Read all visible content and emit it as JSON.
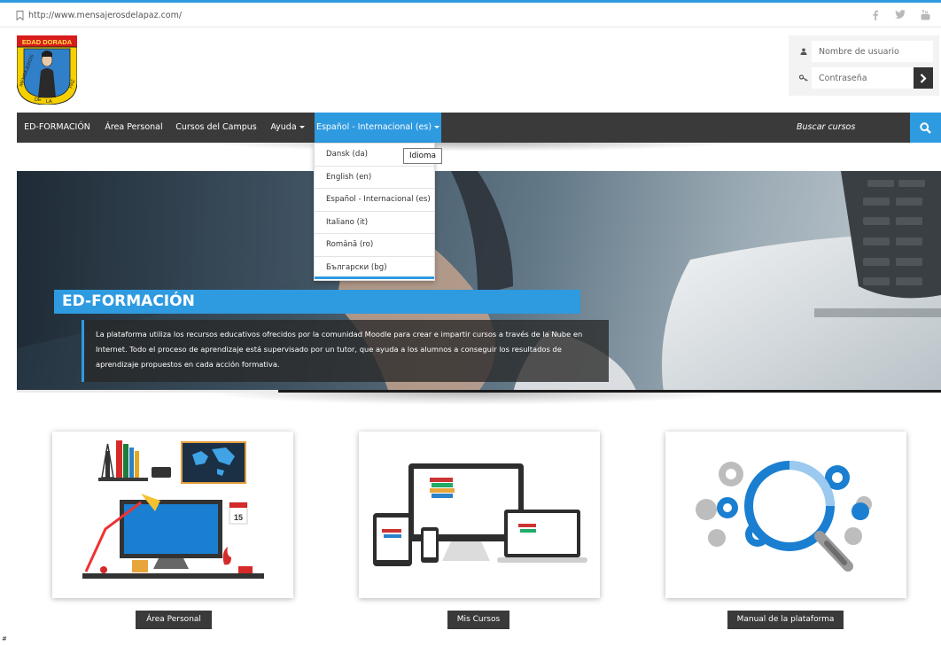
{
  "top_bar": {
    "url": "http://www.mensajerosdelapaz.com/",
    "social_icons": [
      "facebook-icon",
      "twitter-icon",
      "youtube-icon"
    ]
  },
  "logo": {
    "top_text": "EDAD DORADA",
    "ring_text": "MENSAJEROS DE LA PAZ"
  },
  "login": {
    "username_placeholder": "Nombre de usuario",
    "password_placeholder": "Contraseña"
  },
  "nav": {
    "items": [
      {
        "label": "ED-FORMACIÓN"
      },
      {
        "label": "Área Personal"
      },
      {
        "label": "Cursos del Campus"
      },
      {
        "label": "Ayuda"
      },
      {
        "label": "Español - Internacional (es)"
      }
    ],
    "search_label": "Buscar cursos"
  },
  "language_menu": {
    "options": [
      "Dansk (da)",
      "English (en)",
      "Español - Internacional (es)",
      "Italiano (it)",
      "Română (ro)",
      "Български (bg)"
    ],
    "tooltip": "Idioma"
  },
  "slider": {
    "title": "ED-FORMACIÓN",
    "caption": "La plataforma utiliza los recursos educativos ofrecidos por la comunidad Moodle para crear e impartir cursos a través de la Nube en Internet. Todo el proceso de aprendizaje está supervisado por un tutor, que ayuda a los alumnos a conseguir los resultados de aprendizaje propuestos en cada acción formativa."
  },
  "cards": [
    {
      "button": "Área Personal",
      "calendar_day": "15"
    },
    {
      "button": "Mis Cursos"
    },
    {
      "button": "Manual de la plataforma"
    }
  ],
  "footer_mark": "#",
  "colors": {
    "accent": "#2e9ae0",
    "nav_bg": "#3a3a3a",
    "logo_yellow": "#f5d000",
    "logo_red": "#d81b1b"
  }
}
